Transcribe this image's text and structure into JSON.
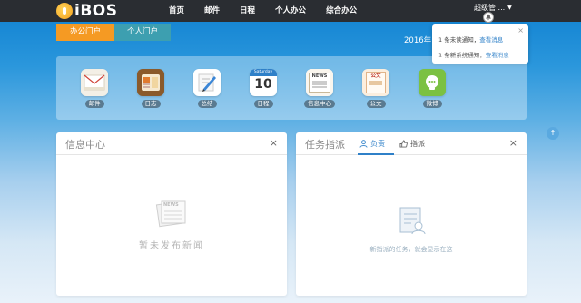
{
  "brand": {
    "logo_text": "iBOS"
  },
  "nav": [
    "首页",
    "邮件",
    "日程",
    "个人办公",
    "综合办公"
  ],
  "user": {
    "name": "超级管 ..."
  },
  "portal_tabs": {
    "office": "办公门户",
    "personal": "个人门户"
  },
  "date": "2016年10",
  "notifications": {
    "line1_text": "1 条未读通知，",
    "line1_link": "查看消息",
    "line2_text": "1 条新系统通知，",
    "line2_link": "查看消息",
    "close": "×"
  },
  "apps": [
    {
      "label": "邮件",
      "icon": "mail-icon"
    },
    {
      "label": "日志",
      "icon": "diary-icon"
    },
    {
      "label": "总结",
      "icon": "summary-icon"
    },
    {
      "label": "日程",
      "icon": "calendar-icon",
      "day": "10",
      "header": "Saturday"
    },
    {
      "label": "信息中心",
      "icon": "news-icon",
      "badge": "NEWS"
    },
    {
      "label": "公文",
      "icon": "document-icon",
      "badge": "公文"
    },
    {
      "label": "微博",
      "icon": "weibo-icon"
    }
  ],
  "info_widget": {
    "title": "信息中心",
    "close": "×",
    "empty_text": "暂未发布新闻",
    "icon_badge": "NEWS"
  },
  "task_widget": {
    "title": "任务指派",
    "close": "×",
    "tab_responsible": "负责",
    "tab_assign": "指派",
    "empty_text": "新指派的任务，就会显示在这"
  },
  "scroll_top": "↑",
  "colors": {
    "topbar": "#2a2d32",
    "tab_active": "#f59a23",
    "tab_inactive": "#3d9fb0",
    "link": "#2f80c8"
  }
}
